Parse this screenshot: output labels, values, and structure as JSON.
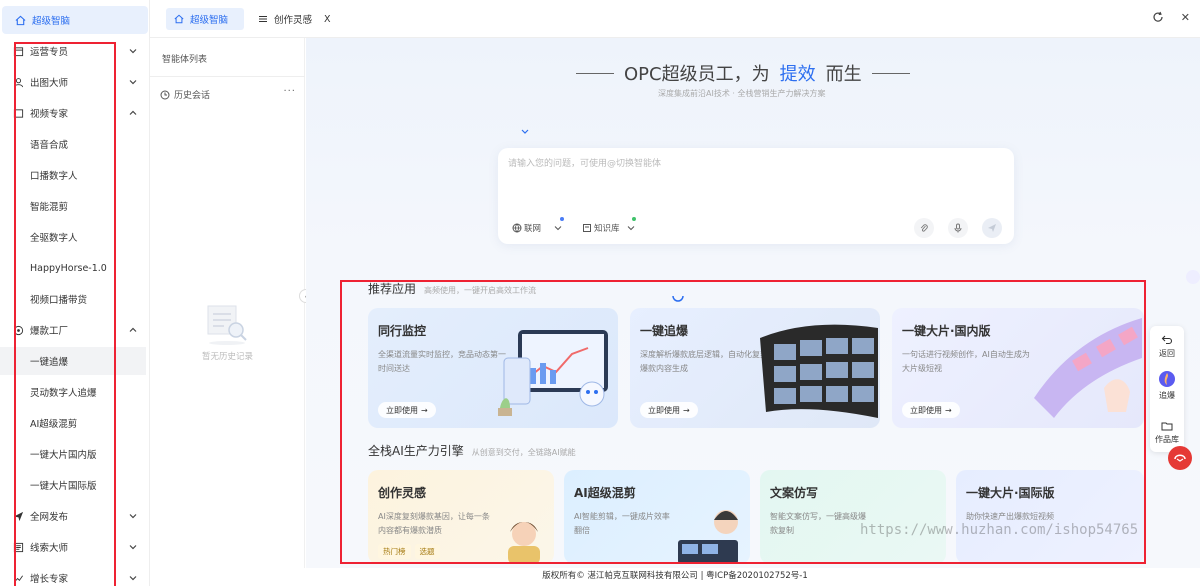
{
  "sidebar": {
    "top_item": "超级智脑",
    "items": [
      {
        "label": "运营专员",
        "type": "group",
        "expanded": false
      },
      {
        "label": "出图大师",
        "type": "group",
        "expanded": false
      },
      {
        "label": "视频专家",
        "type": "group",
        "expanded": true
      },
      {
        "label": "语音合成",
        "type": "sub"
      },
      {
        "label": "口播数字人",
        "type": "sub"
      },
      {
        "label": "智能混剪",
        "type": "sub"
      },
      {
        "label": "全驱数字人",
        "type": "sub"
      },
      {
        "label": "HappyHorse-1.0",
        "type": "sub"
      },
      {
        "label": "视频口播带货",
        "type": "sub"
      },
      {
        "label": "爆款工厂",
        "type": "group",
        "expanded": true
      },
      {
        "label": "一键追爆",
        "type": "sub",
        "active": true
      },
      {
        "label": "灵动数字人追爆",
        "type": "sub"
      },
      {
        "label": "AI超级混剪",
        "type": "sub"
      },
      {
        "label": "一键大片国内版",
        "type": "sub"
      },
      {
        "label": "一键大片国际版",
        "type": "sub"
      },
      {
        "label": "全网发布",
        "type": "group",
        "expanded": false
      },
      {
        "label": "线索大师",
        "type": "group",
        "expanded": false
      },
      {
        "label": "增长专家",
        "type": "group",
        "expanded": false
      }
    ]
  },
  "tabs": {
    "active": "超级智脑",
    "second": "创作灵感",
    "close": "X"
  },
  "panel": {
    "title": "智能体列表",
    "history": "历史会话",
    "more": "···",
    "empty": "暂无历史记录"
  },
  "hero": {
    "title_a": "OPC超级员工，为",
    "title_hl": "提效",
    "title_b": "而生",
    "subtitle": "深度集成前沿AI技术 · 全栈营销生产力解决方案"
  },
  "input": {
    "placeholder": "请输入您的问题，可使用@切换智能体",
    "chip_web": "联网",
    "chip_kb": "知识库"
  },
  "recommend": {
    "title": "推荐应用",
    "subtitle": "高频使用，一键开启高效工作流",
    "cards": [
      {
        "title": "同行监控",
        "desc": "全渠道流量实时监控，竞品动态第一时间送达",
        "btn": "立即使用"
      },
      {
        "title": "一键追爆",
        "desc": "深度解析爆款底层逻辑，自动化复刻爆款内容生成",
        "btn": "立即使用"
      },
      {
        "title": "一键大片·国内版",
        "desc": "一句话进行视频创作，AI自动生成为大片级短视",
        "btn": "立即使用"
      }
    ]
  },
  "engine": {
    "title": "全栈AI生产力引擎",
    "subtitle": "从创意到交付，全链路AI赋能",
    "cards": [
      {
        "title": "创作灵感",
        "desc": "AI深度复刻爆款基因，让每一条内容都有爆款潜质",
        "tags": [
          "热门榜",
          "选题"
        ]
      },
      {
        "title": "AI超级混剪",
        "desc": "AI智能剪辑，一键成片效率翻倍"
      },
      {
        "title": "文案仿写",
        "desc": "智能文案仿写，一键高级爆款复制"
      },
      {
        "title": "一键大片·国际版",
        "desc": "助你快速产出爆款短视频"
      }
    ]
  },
  "rightbar": {
    "back": "返回",
    "chase": "追爆",
    "works": "作品库"
  },
  "watermark": "https://www.huzhan.com/ishop54765",
  "footer": "版权所有© 湛江帕克互联网科技有限公司 | 粤ICP备2020102752号-1",
  "colors": {
    "accent": "#2d6ff0",
    "highlight_box": "#e22233"
  }
}
